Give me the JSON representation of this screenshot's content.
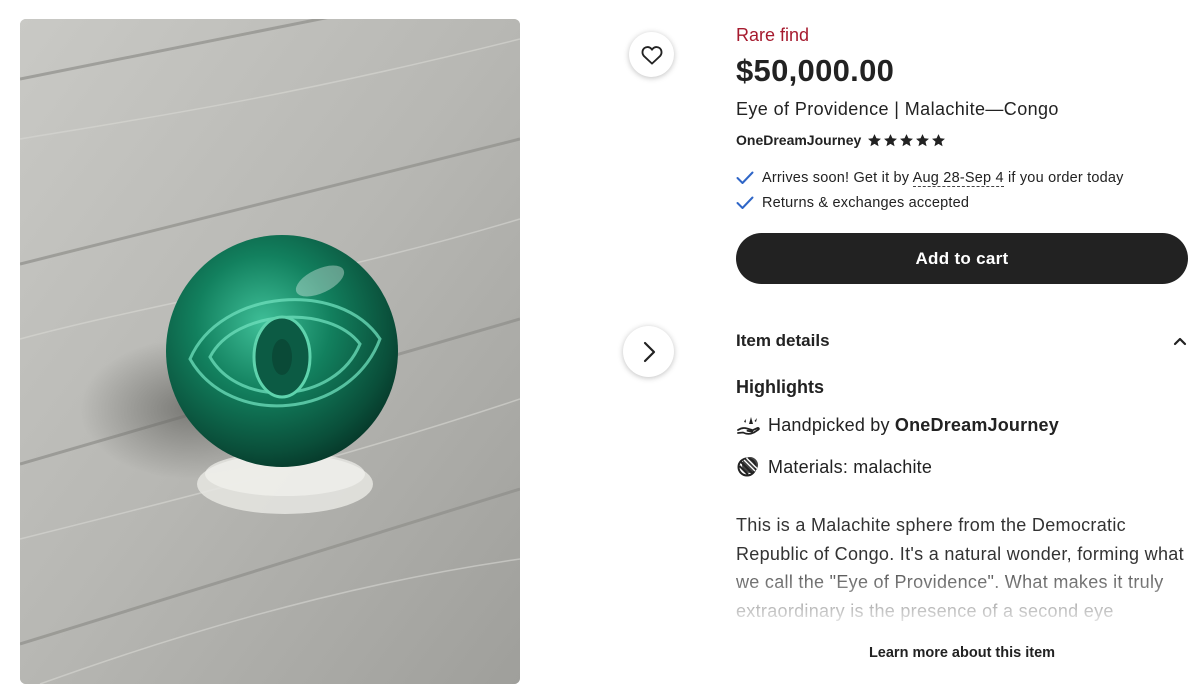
{
  "listing": {
    "badge": "Rare find",
    "price": "$50,000.00",
    "title": "Eye of Providence | Malachite—Congo",
    "shop_name": "OneDreamJourney",
    "rating_stars": 5
  },
  "gallery": {
    "favorite_icon": "heart-icon",
    "next_icon": "chevron-right-icon"
  },
  "perks": {
    "arrival_prefix": "Arrives soon! Get it by ",
    "arrival_dates": "Aug 28-Sep 4",
    "arrival_suffix": " if you order today",
    "returns": "Returns & exchanges accepted"
  },
  "cart": {
    "label": "Add to cart"
  },
  "details": {
    "title": "Item details",
    "highlights_title": "Highlights",
    "handpicked_prefix": "Handpicked by ",
    "handpicked_shop": "OneDreamJourney",
    "materials": "Materials: malachite",
    "description": "This is a Malachite sphere from the Democratic Republic of Congo. It's a natural wonder, forming what we call the \"Eye of Providence\". What makes it truly extraordinary is the presence of a second eye",
    "learn_more": "Learn more about this item"
  },
  "colors": {
    "badge": "#a61a2e",
    "button": "#222222",
    "check": "#2f66c7"
  }
}
